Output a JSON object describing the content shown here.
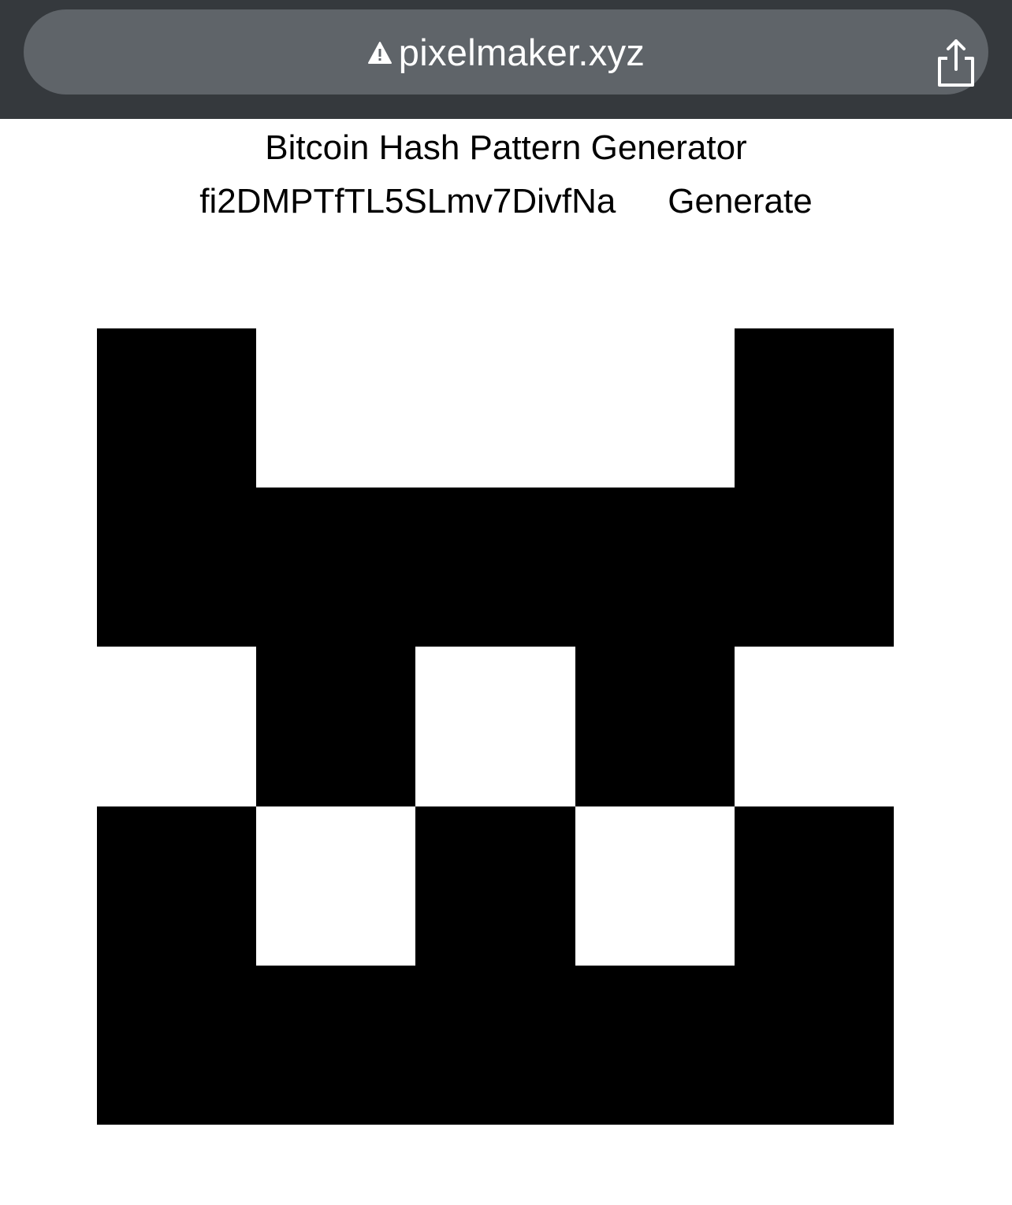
{
  "browser": {
    "url": "pixelmaker.xyz",
    "security_icon": "warning-triangle-icon",
    "share_icon": "share-icon",
    "bar_color": "#35393d",
    "pill_color": "#5f6469"
  },
  "page": {
    "title": "Bitcoin Hash Pattern Generator",
    "hash_value": "fi2DMPTfTL5SLmv7DivfNa",
    "generate_label": "Generate"
  },
  "pattern": {
    "rows": 5,
    "cols": 5,
    "on_color": "#000000",
    "off_color": "#ffffff",
    "grid": [
      [
        1,
        0,
        0,
        0,
        1
      ],
      [
        1,
        1,
        1,
        1,
        1
      ],
      [
        0,
        1,
        0,
        1,
        0
      ],
      [
        1,
        0,
        1,
        0,
        1
      ],
      [
        1,
        1,
        1,
        1,
        1
      ]
    ]
  }
}
